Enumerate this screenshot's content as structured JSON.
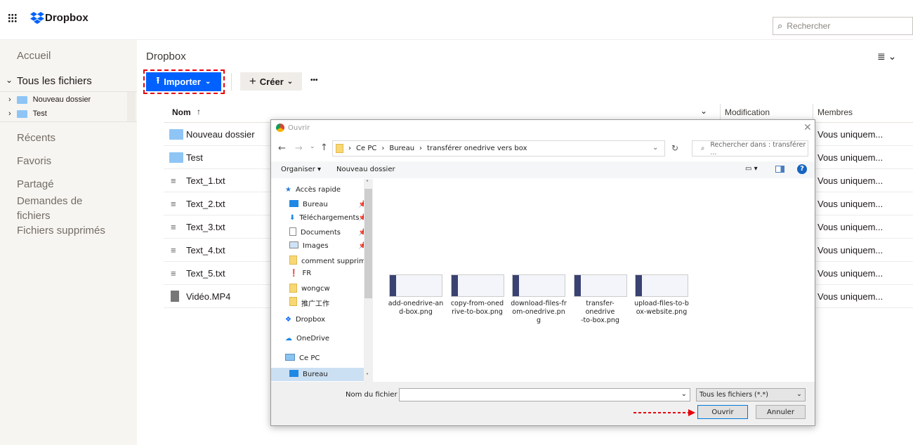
{
  "header": {
    "logo": "Dropbox",
    "search_placeholder": "Rechercher"
  },
  "sidebar": {
    "home": "Accueil",
    "all_files": "Tous les fichiers",
    "tree": [
      "Nouveau dossier",
      "Test"
    ],
    "recent": "Récents",
    "favorites": "Favoris",
    "shared": "Partagé",
    "requests": "Demandes de fichiers",
    "deleted": "Fichiers supprimés"
  },
  "main": {
    "title": "Dropbox",
    "import": "Importer",
    "create": "Créer",
    "more": "•••",
    "col_name": "Nom",
    "col_modified": "Modification",
    "col_members": "Membres",
    "files": [
      {
        "name": "Nouveau dossier",
        "type": "folder",
        "members": "Vous uniquem..."
      },
      {
        "name": "Test",
        "type": "shared-folder",
        "members": "Vous uniquem..."
      },
      {
        "name": "Text_1.txt",
        "type": "text",
        "members": "Vous uniquem..."
      },
      {
        "name": "Text_2.txt",
        "type": "text",
        "members": "Vous uniquem..."
      },
      {
        "name": "Text_3.txt",
        "type": "text",
        "members": "Vous uniquem..."
      },
      {
        "name": "Text_4.txt",
        "type": "text",
        "members": "Vous uniquem..."
      },
      {
        "name": "Text_5.txt",
        "type": "text",
        "members": "Vous uniquem..."
      },
      {
        "name": "Vidéo.MP4",
        "type": "video",
        "members": "Vous uniquem..."
      }
    ]
  },
  "dialog": {
    "title": "Ouvrir",
    "path": [
      "Ce PC",
      "Bureau",
      "transférer onedrive vers box"
    ],
    "search_placeholder": "Rechercher dans : transférer ...",
    "organize": "Organiser",
    "new_folder": "Nouveau dossier",
    "nav": [
      {
        "label": "Accès rapide",
        "kind": "star",
        "indent": 0
      },
      {
        "label": "Bureau",
        "kind": "desktop",
        "indent": 1,
        "pin": true
      },
      {
        "label": "Téléchargements",
        "kind": "download",
        "indent": 1,
        "pin": true
      },
      {
        "label": "Documents",
        "kind": "doc",
        "indent": 1,
        "pin": true
      },
      {
        "label": "Images",
        "kind": "image",
        "indent": 1,
        "pin": true
      },
      {
        "label": "comment supprimer",
        "kind": "folder",
        "indent": 1
      },
      {
        "label": "FR",
        "kind": "error-folder",
        "indent": 1
      },
      {
        "label": "wongcw",
        "kind": "folder",
        "indent": 1
      },
      {
        "label": "推广工作",
        "kind": "folder",
        "indent": 1
      },
      {
        "label": "Dropbox",
        "kind": "dropbox",
        "indent": 0
      },
      {
        "label": "OneDrive",
        "kind": "cloud",
        "indent": 0
      },
      {
        "label": "Ce PC",
        "kind": "pc",
        "indent": 0
      },
      {
        "label": "Bureau",
        "kind": "desktop",
        "indent": 1,
        "selected": true
      }
    ],
    "files": [
      [
        "add-onedrive-an",
        "d-box.png"
      ],
      [
        "copy-from-oned",
        "rive-to-box.png"
      ],
      [
        "download-files-fr",
        "om-onedrive.pn",
        "g"
      ],
      [
        "transfer-onedrive",
        "-to-box.png"
      ],
      [
        "upload-files-to-b",
        "ox-website.png"
      ]
    ],
    "filename_label": "Nom du fichier :",
    "filename_value": "",
    "filetype": "Tous les fichiers (*.*)",
    "open": "Ouvrir",
    "cancel": "Annuler"
  },
  "colors": {
    "accent": "#0061fe",
    "highlight": "#e8000b"
  }
}
